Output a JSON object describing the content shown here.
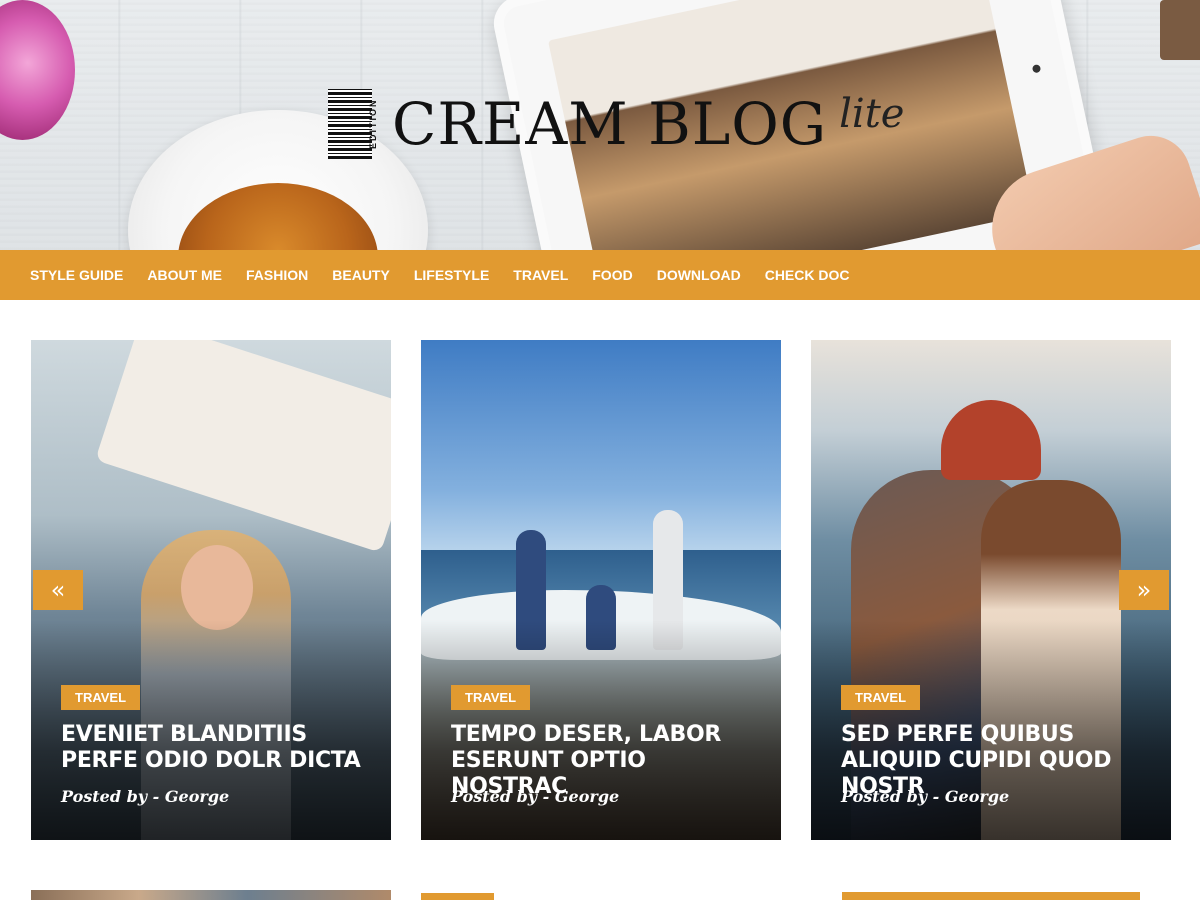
{
  "site": {
    "logo_main": "CREAM BLOG",
    "logo_sub": "lite",
    "logo_edition": "EDITION"
  },
  "nav": {
    "items": [
      {
        "label": "STYLE GUIDE"
      },
      {
        "label": "ABOUT ME"
      },
      {
        "label": "FASHION"
      },
      {
        "label": "BEAUTY"
      },
      {
        "label": "LIFESTYLE"
      },
      {
        "label": "TRAVEL"
      },
      {
        "label": "FOOD"
      },
      {
        "label": "DOWNLOAD"
      },
      {
        "label": "CHECK DOC"
      }
    ]
  },
  "slider": {
    "prev_label": "«",
    "next_label": "»",
    "cards": [
      {
        "category": "TRAVEL",
        "title": "EVENIET BLANDITIIS PERFE ODIO DOLR DICTA",
        "meta": "Posted by - George"
      },
      {
        "category": "TRAVEL",
        "title": "TEMPO DESER, LABOR ESERUNT OPTIO NOSTRAC",
        "meta": "Posted by - George"
      },
      {
        "category": "TRAVEL",
        "title": "SED PERFE QUIBUS ALIQUID CUPIDI QUOD NOSTR",
        "meta": "Posted by - George"
      }
    ]
  },
  "colors": {
    "accent": "#e19a30",
    "text_on_accent": "#ffffff"
  }
}
